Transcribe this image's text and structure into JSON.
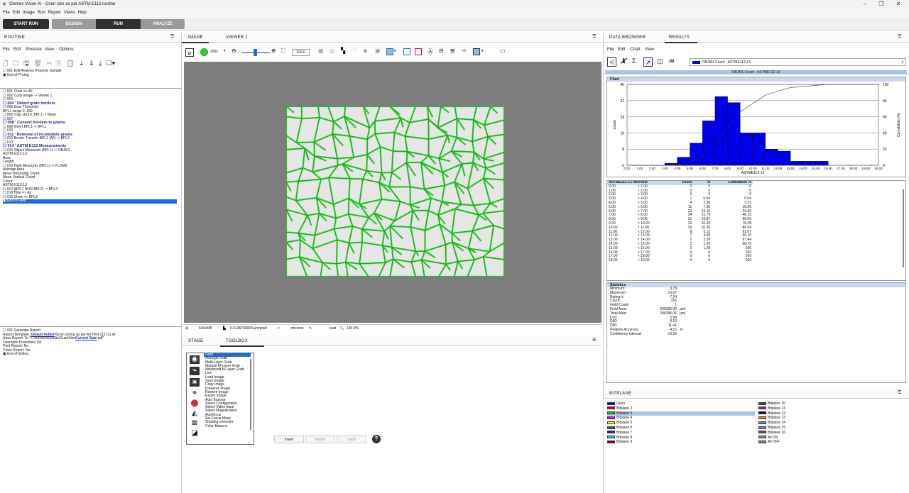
{
  "title": "Clemex Vision AI - Grain size as per ASTM-E112.routine",
  "menu": [
    "File",
    "Edit",
    "Image",
    "Run",
    "Report",
    "Views",
    "Help"
  ],
  "runbar": {
    "start": "START RUN",
    "modes": [
      "DESIGN",
      "RUN",
      "ANALYZE"
    ]
  },
  "routine": {
    "header": "ROUTINE",
    "menu": [
      "File",
      "Edit",
      "Execute",
      "View",
      "Options"
    ],
    "prolog": [
      "☐ 001 Edit Analysis Property Sample",
      "▣ End of Prolog"
    ],
    "steps": [
      {
        "t": "☐ 001 Clear => All",
        "c": ""
      },
      {
        "t": "☐ 002 Copy Image -> Viewer 1",
        "c": ""
      },
      {
        "t": "☐ 003",
        "c": ""
      },
      {
        "t": "☐ 004 ' Detect grain borders",
        "c": "b"
      },
      {
        "t": "☐ 005 Gray Threshold",
        "c": ""
      },
      {
        "t": "      BPL1 range 0..189",
        "c": ""
      },
      {
        "t": "☐ 006 Trap 10x10, BPL1 -> None",
        "c": ""
      },
      {
        "t": "☐ 007",
        "c": ""
      },
      {
        "t": "☐ 008 ' Convert borders to grains",
        "c": "b"
      },
      {
        "t": "☐ 009 Invert BPL1 -> BPL1",
        "c": ""
      },
      {
        "t": "☐ 010",
        "c": ""
      },
      {
        "t": "☐ 011 ' Removal of incomplete grains",
        "c": "b"
      },
      {
        "t": "☐ 012 Border Transfer BPL1 (All) -> BPL2",
        "c": ""
      },
      {
        "t": "☐ 013",
        "c": ""
      },
      {
        "t": "☐ 014 ' ASTM E112 Measurements",
        "c": "b"
      },
      {
        "t": "☐ 015 Object Measures (BPL1) -> OBJM1",
        "c": ""
      },
      {
        "t": "      ASTM E112-13",
        "c": ""
      },
      {
        "t": "      Area",
        "c": ""
      },
      {
        "t": "      Length",
        "c": ""
      },
      {
        "t": "☐ 016 Field Measures (BPL1) -> FLDM2",
        "c": ""
      },
      {
        "t": "      Average Area",
        "c": ""
      },
      {
        "t": "      Mean Horizontal Chord",
        "c": ""
      },
      {
        "t": "      Mean Vertical Chord",
        "c": ""
      },
      {
        "t": "      Count",
        "c": ""
      },
      {
        "t": "      ASTM E112-13",
        "c": ""
      },
      {
        "t": "☐ 017 (BPL1 NOR BPL2) -> BPL3",
        "c": ""
      },
      {
        "t": "☐ 018 Hide => All",
        "c": ""
      },
      {
        "t": "☐ 019 Show => BPL3",
        "c": ""
      },
      {
        "t": "▣ End of Field",
        "c": "sel"
      }
    ],
    "epilog": [
      {
        "t": "☐ 001 Generate Report",
        "c": ""
      },
      {
        "t": "      Report Template: ",
        "link": "Default Folder",
        "rest": "\\Grain Sizing as per ASTM E112 (1).xlt"
      },
      {
        "t": "      Save Report: To \"C:\\AIFiles\\Results\\GrainSize",
        "link": "Current Date",
        "rest": ".pdf\""
      },
      {
        "t": "      Overwrite Protection: No",
        "c": ""
      },
      {
        "t": "      Print Report: No",
        "c": ""
      },
      {
        "t": "      Close Report: No",
        "c": ""
      },
      {
        "t": "▣ End of Epilog",
        "c": ""
      }
    ]
  },
  "image": {
    "tabs": [
      "IMAGE",
      "VIEWER 1"
    ],
    "zoom": "200x",
    "zoom_value": "100.0",
    "status": {
      "size": "640x480",
      "calib": "0.6136700000 µm/pixel",
      "unit": "microns",
      "load": "load",
      "zoom": "100.0%"
    }
  },
  "toolbox": {
    "tabs": [
      "STAGE",
      "TOOLBOX"
    ],
    "items": [
      "Grab",
      "Average Grab",
      "Multi-Layer Grab",
      "Manual M-Layer Grab",
      "Advanced M-Layer Grab",
      "Live",
      "Load Image",
      "Save Image",
      "Copy Image",
      "Preserve Image",
      "Restore Image",
      "Export Image",
      "Auto Expose",
      "Select Configuration",
      "Select Video Input",
      "Select Magnification",
      "Autofocus",
      "Set Focus Mask",
      "Shading corrector",
      "Color Balance"
    ],
    "buttons": {
      "insert": "Insert",
      "modify": "Modify",
      "undo": "Undo"
    }
  },
  "results": {
    "tabs": [
      "DATA BROWSER",
      "RESULTS"
    ],
    "menu": [
      "File",
      "Edit",
      "Chart",
      "View"
    ],
    "precision": ".00",
    "selector": "OBJM1 Count - ASTME112-13",
    "band": "OBJM1 Count - ASTME112-13",
    "chart_label": "Chart",
    "table_label": "ASTME112-13 Intervals",
    "table_cols": [
      "Count",
      "%",
      "Cumulative %"
    ],
    "stats_label": "Statistics",
    "stats": [
      [
        "Minimum:",
        "3.78",
        ""
      ],
      [
        "Maximum:",
        "15.97",
        ""
      ],
      [
        "Rating #:",
        "7.24",
        ""
      ],
      [
        "Count:",
        "156",
        ""
      ],
      [
        "Field Count:",
        "1",
        ""
      ],
      [
        "Field Area:",
        "206395.06",
        "µm²"
      ],
      [
        "Total Area:",
        "206395.06",
        "µm²"
      ],
      [
        "D10:",
        "5.99",
        ""
      ],
      [
        "D50:",
        "8.10",
        ""
      ],
      [
        "D90:",
        "11.41",
        ""
      ],
      [
        "Relative Accuracy:",
        "4.15",
        "%"
      ],
      [
        "Confidence Interval:",
        "±0.35",
        ""
      ]
    ]
  },
  "chart_data": {
    "type": "bar",
    "title": "",
    "xlabel": "ASTME112-13",
    "ylabel": "Count",
    "y2label": "Cumulative (%)",
    "x_ticks": [
      "0.00",
      "1.00",
      "2.00",
      "3.00",
      "4.00",
      "5.00",
      "6.00",
      "7.00",
      "8.00",
      "9.00",
      "10.00",
      "11.00",
      "12.00",
      "13.00",
      "14.00",
      "15.00",
      "16.00",
      "17.00",
      "18.00",
      "19.00",
      "20.00"
    ],
    "y_ticks": [
      "0",
      "8",
      "16",
      "24",
      "32",
      "40"
    ],
    "y2_ticks": [
      "0",
      "20",
      "40",
      "60",
      "80",
      "100"
    ],
    "ylim": [
      0,
      40
    ],
    "y2lim": [
      0,
      100
    ],
    "xlim": [
      0,
      20
    ],
    "bin_start": [
      0,
      1,
      2,
      3,
      4,
      5,
      6,
      7,
      8,
      9,
      10,
      11,
      12,
      13,
      14,
      15,
      16,
      17,
      18,
      19
    ],
    "counts": [
      0,
      0,
      0,
      1,
      4,
      11,
      22,
      34,
      31,
      16,
      16,
      8,
      7,
      2,
      2,
      2,
      0,
      0,
      0,
      0
    ],
    "cumulative": [
      0,
      0,
      0,
      0.64,
      3.21,
      10.26,
      24.36,
      46.15,
      66.03,
      76.28,
      86.54,
      91.67,
      96.15,
      97.44,
      98.72,
      100,
      100,
      100,
      100,
      100
    ],
    "bar_color": "#0000e6",
    "legend": "none"
  },
  "intervals": [
    [
      "0.00",
      "< 1.00",
      "0",
      "0",
      "0"
    ],
    [
      "1.00",
      "< 2.00",
      "0",
      "0",
      "0"
    ],
    [
      "2.00",
      "< 3.00",
      "0",
      "0",
      "0"
    ],
    [
      "3.00",
      "< 4.00",
      "1",
      "0.64",
      "0.64"
    ],
    [
      "4.00",
      "< 5.00",
      "4",
      "2.56",
      "3.21"
    ],
    [
      "5.00",
      "< 6.00",
      "11",
      "7.05",
      "10.26"
    ],
    [
      "6.00",
      "< 7.00",
      "22",
      "14.10",
      "24.36"
    ],
    [
      "7.00",
      "< 8.00",
      "34",
      "21.79",
      "46.15"
    ],
    [
      "8.00",
      "< 9.00",
      "31",
      "19.87",
      "66.03"
    ],
    [
      "9.00",
      "< 10.00",
      "16",
      "10.26",
      "76.28"
    ],
    [
      "10.00",
      "< 11.00",
      "16",
      "10.26",
      "86.54"
    ],
    [
      "11.00",
      "< 12.00",
      "8",
      "5.13",
      "91.67"
    ],
    [
      "12.00",
      "< 13.00",
      "7",
      "4.49",
      "96.15"
    ],
    [
      "13.00",
      "< 14.00",
      "2",
      "1.28",
      "97.44"
    ],
    [
      "14.00",
      "< 15.00",
      "2",
      "1.28",
      "98.72"
    ],
    [
      "15.00",
      "< 16.00",
      "2",
      "1.28",
      "100"
    ],
    [
      "16.00",
      "< 17.00",
      "0",
      "0",
      "100"
    ],
    [
      "17.00",
      "< 18.00",
      "0",
      "0",
      "100"
    ],
    [
      "18.00",
      "< 19.00",
      "0",
      "0",
      "100"
    ]
  ],
  "bitplane": {
    "header": "BITPLANE",
    "left": [
      {
        "n": "Grain",
        "c": "#0000ff"
      },
      {
        "n": "Bitplane 2",
        "c": "#e00000"
      },
      {
        "n": "Bitplane 3",
        "c": "#00d000"
      },
      {
        "n": "Bitplane 4",
        "c": "#ff00ff"
      },
      {
        "n": "Bitplane 5",
        "c": "#ffff00"
      },
      {
        "n": "Bitplane 6",
        "c": "#008080"
      },
      {
        "n": "Bitplane 7",
        "c": "#800080"
      },
      {
        "n": "Bitplane 8",
        "c": "#00e0e0"
      },
      {
        "n": "Bitplane 9",
        "c": "#800000"
      }
    ],
    "right": [
      {
        "n": "Bitplane 10",
        "c": "#008000"
      },
      {
        "n": "Bitplane 11",
        "c": "#c000c0"
      },
      {
        "n": "Bitplane 12",
        "c": "#000080"
      },
      {
        "n": "Bitplane 13",
        "c": "#ff8000"
      },
      {
        "n": "Bitplane 14",
        "c": "#3399ff"
      },
      {
        "n": "Bitplane 15",
        "c": "#a070c0"
      },
      {
        "n": "Bitplane 16",
        "c": "#606030"
      },
      {
        "n": "All ON",
        "c": "#888888"
      },
      {
        "n": "All OFF",
        "c": "#888888"
      }
    ]
  }
}
